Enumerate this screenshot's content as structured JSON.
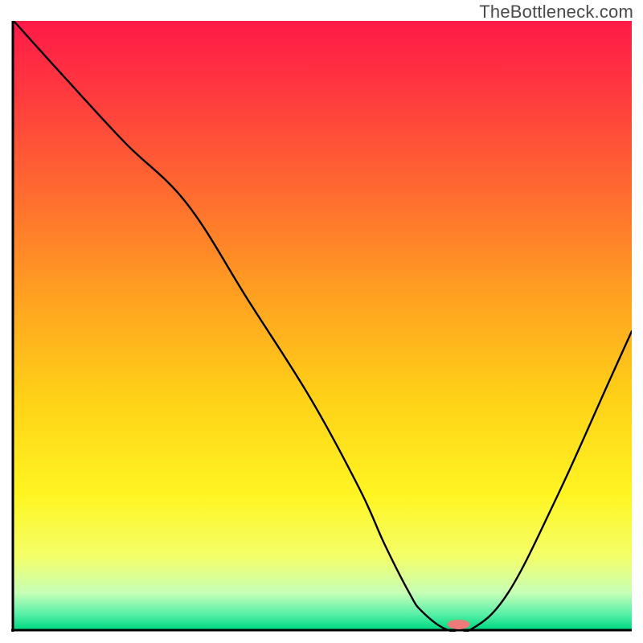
{
  "watermark": "TheBottleneck.com",
  "chart_data": {
    "type": "line",
    "title": "",
    "xlabel": "",
    "ylabel": "",
    "xlim": [
      0,
      100
    ],
    "ylim": [
      0,
      100
    ],
    "grid": false,
    "legend": false,
    "background_gradient": {
      "stops": [
        {
          "pos": 0.0,
          "color": "#ff1a47"
        },
        {
          "pos": 0.12,
          "color": "#ff3a3f"
        },
        {
          "pos": 0.28,
          "color": "#ff6a30"
        },
        {
          "pos": 0.45,
          "color": "#ffa021"
        },
        {
          "pos": 0.62,
          "color": "#ffd117"
        },
        {
          "pos": 0.78,
          "color": "#fff523"
        },
        {
          "pos": 0.88,
          "color": "#f4ff69"
        },
        {
          "pos": 0.94,
          "color": "#c7ffb7"
        },
        {
          "pos": 0.975,
          "color": "#58f0a7"
        },
        {
          "pos": 1.0,
          "color": "#00d982"
        }
      ]
    },
    "series": [
      {
        "name": "bottleneck-curve",
        "color": "#000000",
        "x": [
          0,
          8,
          18,
          28,
          38,
          48,
          56,
          60,
          64,
          66,
          70,
          74,
          80,
          88,
          96,
          100
        ],
        "y": [
          100,
          91,
          80,
          70,
          54,
          38,
          23,
          14,
          6,
          3,
          0,
          0,
          6,
          22,
          40,
          49
        ]
      }
    ],
    "marker": {
      "name": "optimal-point",
      "x": 72,
      "y": 0.8,
      "color": "#ef7a7a",
      "rx": 14,
      "ry": 6
    },
    "axes": {
      "left": {
        "visible": true,
        "color": "#000000"
      },
      "bottom": {
        "visible": true,
        "color": "#000000"
      }
    }
  }
}
